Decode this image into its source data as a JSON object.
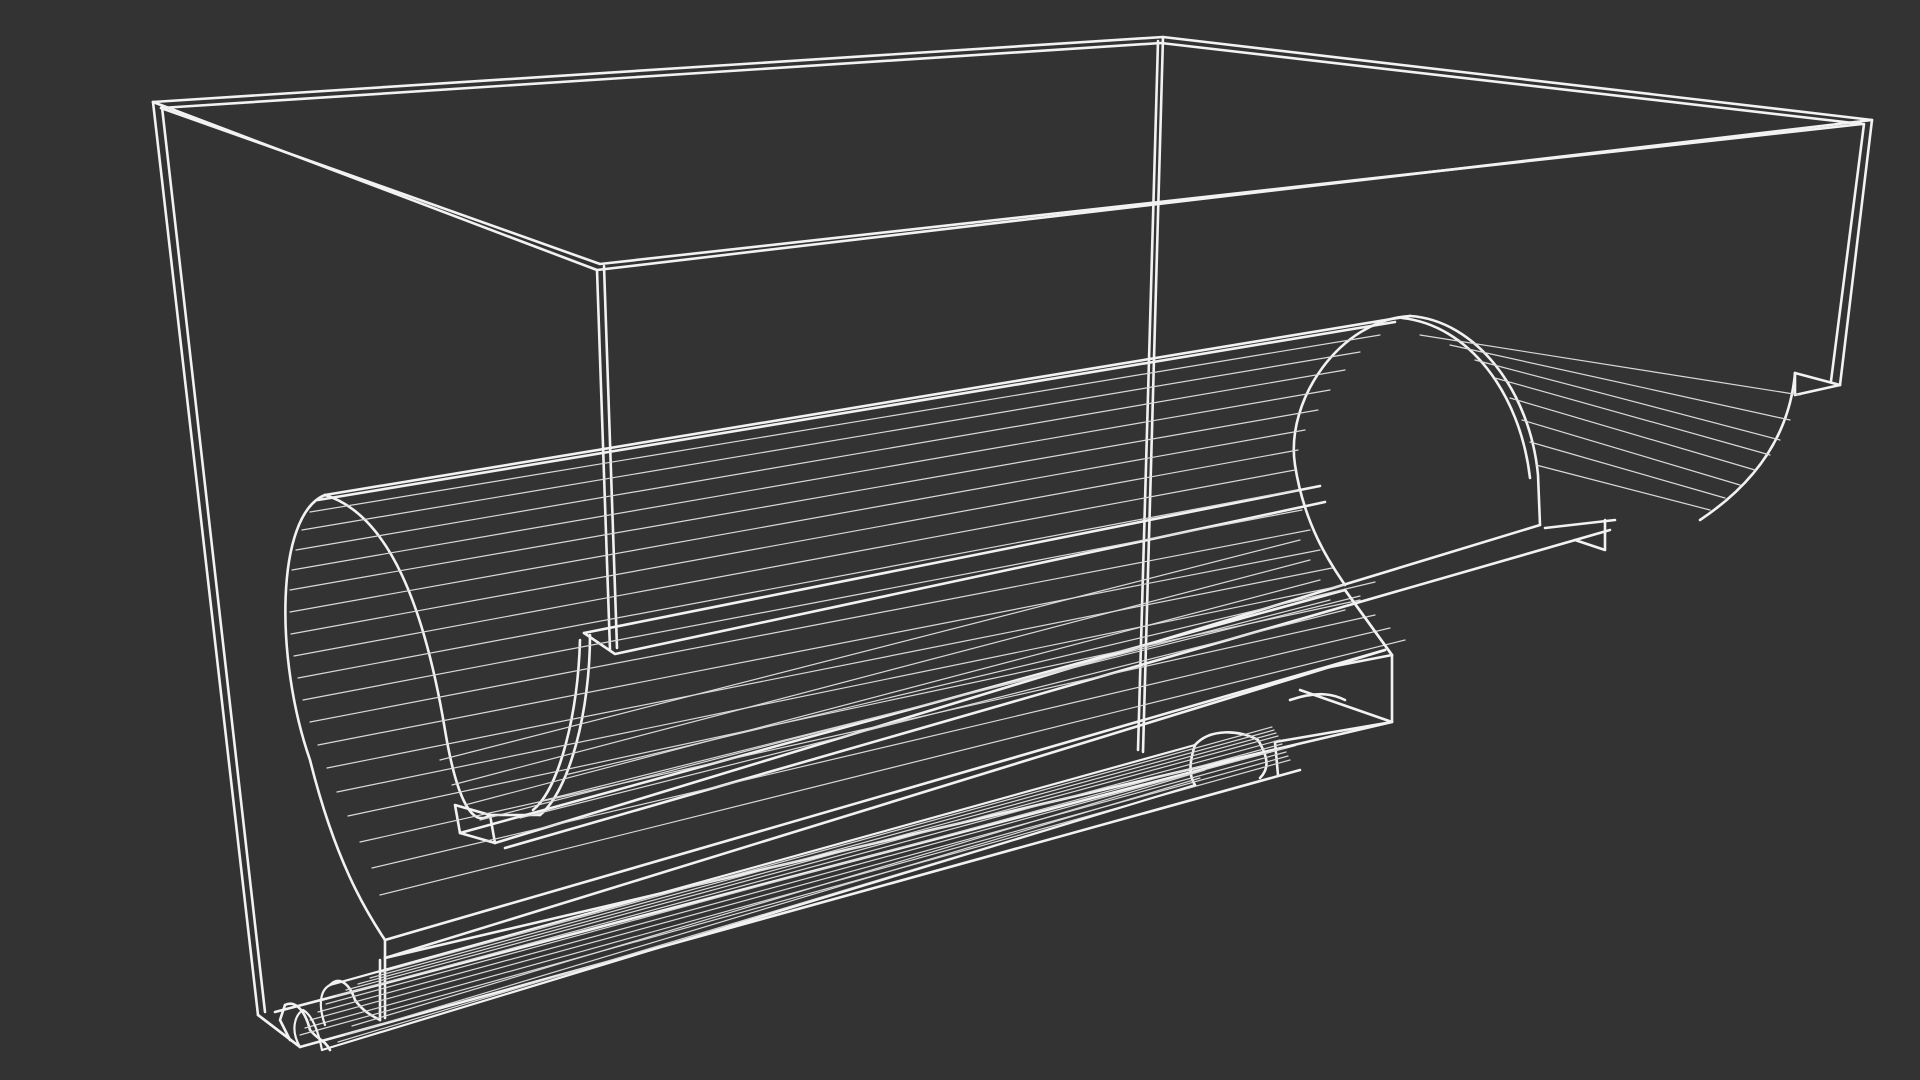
{
  "viewport": {
    "background": "#333333",
    "wire_color": "#f2f2f2",
    "fine_wire_color": "#d9d9d9",
    "render_mode": "wireframe",
    "text": ""
  },
  "model": {
    "parts": [
      "box-enclosure",
      "large-half-cylinder-channel",
      "rectangular-slot",
      "lower-groove-channel",
      "small-lower-tube"
    ]
  }
}
